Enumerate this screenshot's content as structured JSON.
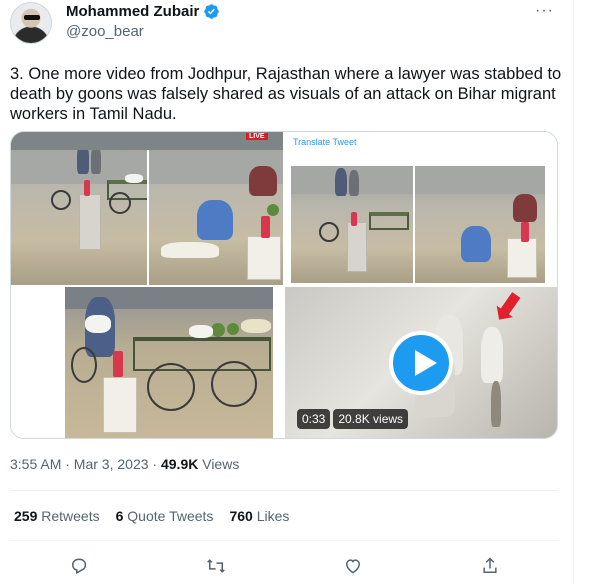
{
  "author": {
    "name": "Mohammed Zubair",
    "handle": "@zoo_bear",
    "more_label": "···"
  },
  "tweet": {
    "text": "3. One more video from Jodhpur, Rajasthan where a lawyer was stabbed to death by goons was falsely shared as visuals of an attack on Bihar migrant workers in Tamil Nadu."
  },
  "media": {
    "live_badge": "LIVE",
    "translate_label": "Translate Tweet",
    "video_duration": "0:33",
    "video_views": "20.8K views"
  },
  "meta": {
    "time": "3:55 AM · Mar 3, 2023",
    "separator": "·",
    "views_count": "49.9K",
    "views_label": "Views"
  },
  "stats": {
    "retweets_count": "259",
    "retweets_label": "Retweets",
    "quotes_count": "6",
    "quotes_label": "Quote Tweets",
    "likes_count": "760",
    "likes_label": "Likes"
  },
  "icons": {
    "reply": "reply-icon",
    "retweet": "retweet-icon",
    "like": "heart-icon",
    "share": "share-icon",
    "verified": "verified-badge-icon"
  },
  "colors": {
    "accent": "#1d9bf0",
    "muted": "#536471",
    "text": "#0f1419",
    "border": "#cfd9de"
  }
}
